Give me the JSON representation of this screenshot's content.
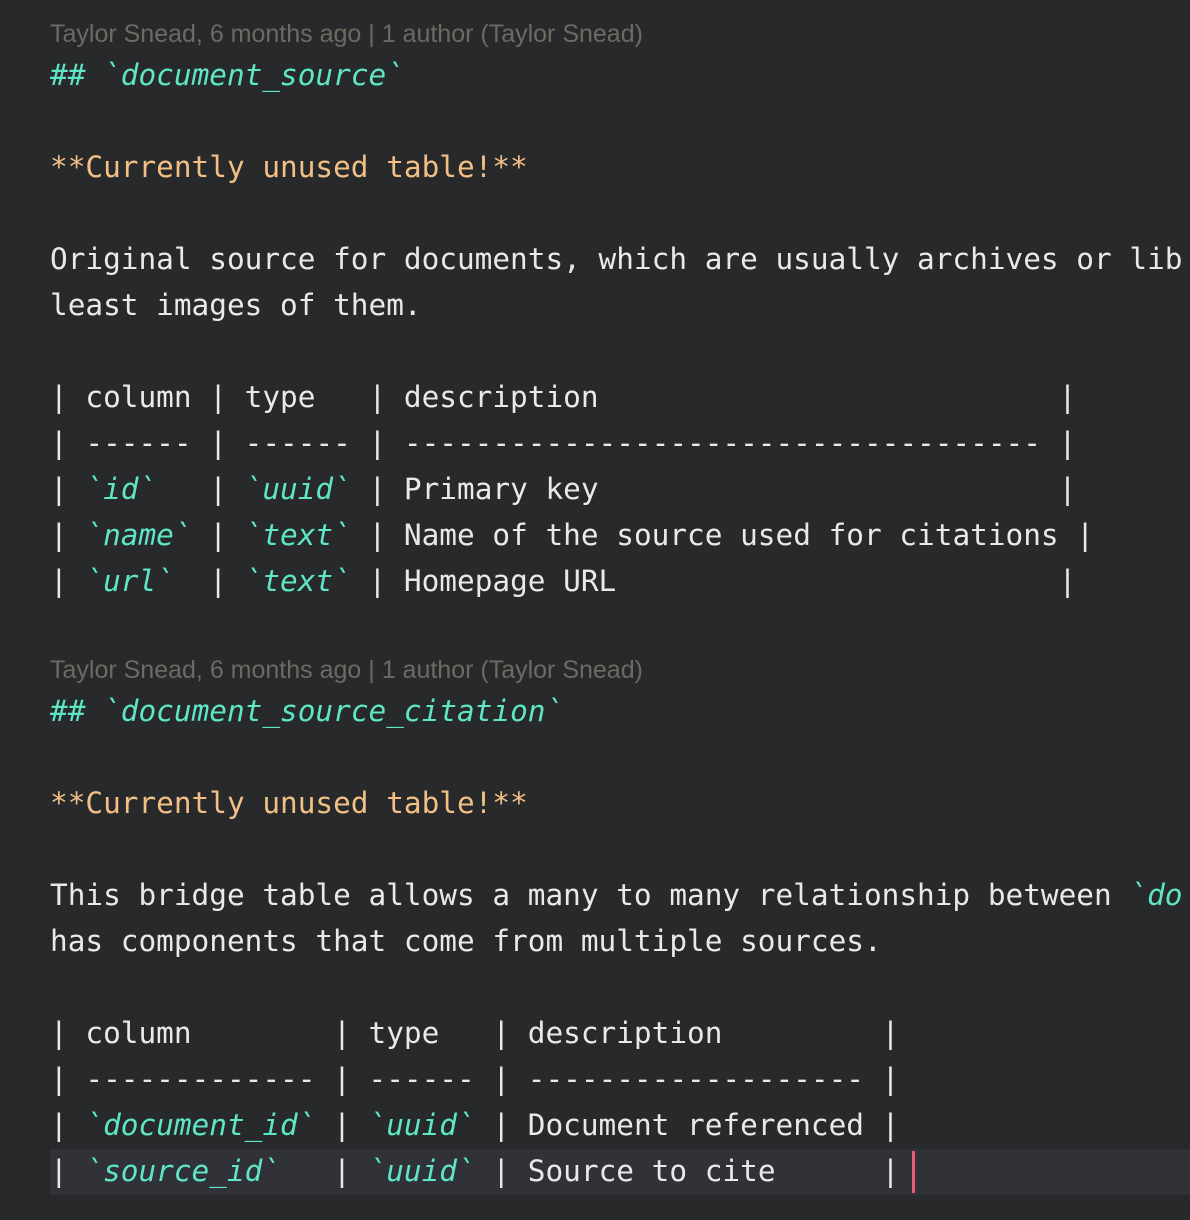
{
  "editor": {
    "section1": {
      "blame": "Taylor Snead, 6 months ago | 1 author (Taylor Snead)",
      "heading_prefix": "## ",
      "heading_code": "`document_source`",
      "bold_note": "**Currently unused table!**",
      "paragraph_line1": "Original source for documents, which are usually archives or lib",
      "paragraph_line2": "least images of them.",
      "table": [
        [
          {
            "t": "| column | type   | description                          |"
          }
        ],
        [
          {
            "t": "| ------ | ------ | ------------------------------------ |"
          }
        ],
        [
          {
            "t": "| "
          },
          {
            "t": "`id`",
            "c": true
          },
          {
            "t": "   | "
          },
          {
            "t": "`uuid`",
            "c": true
          },
          {
            "t": " | Primary key                          |"
          }
        ],
        [
          {
            "t": "| "
          },
          {
            "t": "`name`",
            "c": true
          },
          {
            "t": " | "
          },
          {
            "t": "`text`",
            "c": true
          },
          {
            "t": " | Name of the source used for citations |"
          }
        ],
        [
          {
            "t": "| "
          },
          {
            "t": "`url`",
            "c": true
          },
          {
            "t": "  | "
          },
          {
            "t": "`text`",
            "c": true
          },
          {
            "t": " | Homepage URL                         |"
          }
        ]
      ]
    },
    "section2": {
      "blame": "Taylor Snead, 6 months ago | 1 author (Taylor Snead)",
      "heading_prefix": "## ",
      "heading_code": "`document_source_citation`",
      "bold_note": "**Currently unused table!**",
      "paragraph_line1_text": "This bridge table allows a many to many relationship between ",
      "paragraph_line1_code": "`do",
      "paragraph_line2": "has components that come from multiple sources.",
      "table": [
        [
          {
            "t": "| column        | type   | description         |"
          }
        ],
        [
          {
            "t": "| ------------- | ------ | ------------------- |"
          }
        ],
        [
          {
            "t": "| "
          },
          {
            "t": "`document_id`",
            "c": true
          },
          {
            "t": " | "
          },
          {
            "t": "`uuid`",
            "c": true
          },
          {
            "t": " | Document referenced |"
          }
        ],
        [
          {
            "t": "| "
          },
          {
            "t": "`source_id`",
            "c": true
          },
          {
            "t": "   | "
          },
          {
            "t": "`uuid`",
            "c": true
          },
          {
            "t": " | Source to cite      |"
          }
        ]
      ]
    }
  }
}
